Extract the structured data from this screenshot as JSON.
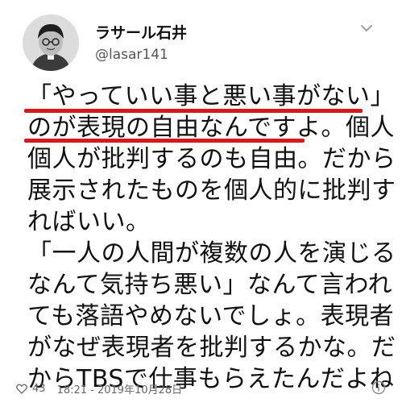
{
  "user": {
    "display_name": "ラサール石井",
    "handle": "@lasar141"
  },
  "tweet": {
    "lines": [
      "「やっていい事と悪い事がない」",
      "のが表現の自由なんですよ。個人",
      "個人が批判するのも自由。だから",
      "展示されたものを個人的に批判す",
      "ればいい。",
      "「一人の人間が複数の人を演じる",
      "なんて気持ち悪い」なんて言われ",
      "ても落語やめないでしょ。表現者",
      "がなぜ表現者を批判するかな。だ",
      "からTBSで仕事もらえたんだよね"
    ]
  },
  "footer": {
    "likes": "43",
    "timestamp": "18:21 - 2019年10月28日"
  },
  "icons": {
    "avatar": "avatar-photo",
    "menu": "chevron-down-icon",
    "like": "heart-icon",
    "info": "info-icon"
  },
  "colors": {
    "underline": "#d5191f",
    "meta_text": "#666666"
  }
}
